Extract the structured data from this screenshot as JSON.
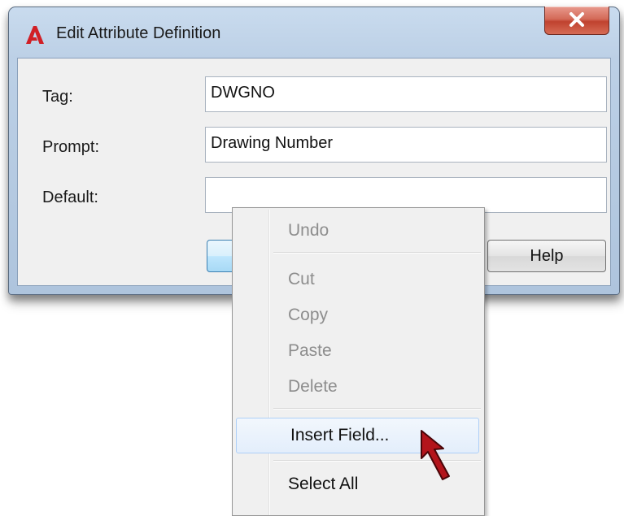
{
  "dialog": {
    "title": "Edit Attribute Definition",
    "fields": {
      "tag": {
        "label": "Tag:",
        "value": "DWGNO"
      },
      "prompt": {
        "label": "Prompt:",
        "value": "Drawing Number"
      },
      "default": {
        "label": "Default:",
        "value": ""
      }
    },
    "buttons": {
      "help": "Help"
    },
    "icons": {
      "app": "autocad-a-icon",
      "close": "close-icon"
    },
    "colors": {
      "app_icon": "#d11f26",
      "close_button": "#c8462f"
    }
  },
  "context_menu": {
    "items": [
      {
        "label": "Undo",
        "enabled": false
      },
      {
        "label": "Cut",
        "enabled": false
      },
      {
        "label": "Copy",
        "enabled": false
      },
      {
        "label": "Paste",
        "enabled": false
      },
      {
        "label": "Delete",
        "enabled": false
      },
      {
        "label": "Insert Field...",
        "enabled": true,
        "highlighted": true
      },
      {
        "label": "Select All",
        "enabled": true
      }
    ]
  },
  "annotation": {
    "pointer": "red-arrow-cursor-icon",
    "color": "#b3141b"
  }
}
